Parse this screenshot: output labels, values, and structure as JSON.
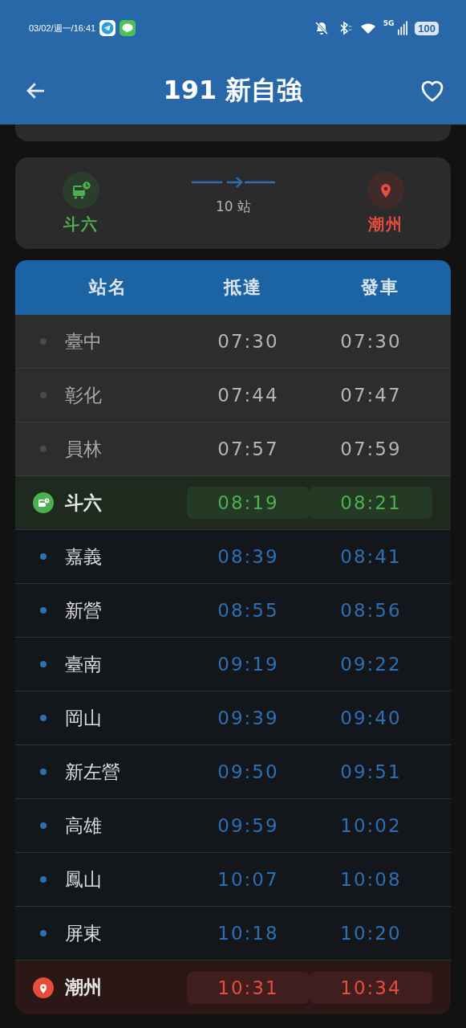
{
  "status_bar": {
    "datetime": "03/02/週一/16:41",
    "network": "5G",
    "battery": "100"
  },
  "app_bar": {
    "title": "191 新自強",
    "favorite": false
  },
  "route": {
    "origin": "斗六",
    "stops": "10 站",
    "destination": "潮州"
  },
  "table": {
    "columns": [
      "站名",
      "抵達",
      "發車"
    ],
    "rows": [
      {
        "kind": "passed",
        "station": "臺中",
        "arrive": "07:30",
        "depart": "07:30"
      },
      {
        "kind": "passed",
        "station": "彰化",
        "arrive": "07:44",
        "depart": "07:47"
      },
      {
        "kind": "passed",
        "station": "員林",
        "arrive": "07:57",
        "depart": "07:59"
      },
      {
        "kind": "boarding",
        "station": "斗六",
        "arrive": "08:19",
        "depart": "08:21"
      },
      {
        "kind": "upcoming",
        "station": "嘉義",
        "arrive": "08:39",
        "depart": "08:41"
      },
      {
        "kind": "upcoming",
        "station": "新營",
        "arrive": "08:55",
        "depart": "08:56"
      },
      {
        "kind": "upcoming",
        "station": "臺南",
        "arrive": "09:19",
        "depart": "09:22"
      },
      {
        "kind": "upcoming",
        "station": "岡山",
        "arrive": "09:39",
        "depart": "09:40"
      },
      {
        "kind": "upcoming",
        "station": "新左營",
        "arrive": "09:50",
        "depart": "09:51"
      },
      {
        "kind": "upcoming",
        "station": "高雄",
        "arrive": "09:59",
        "depart": "10:02"
      },
      {
        "kind": "upcoming",
        "station": "鳳山",
        "arrive": "10:07",
        "depart": "10:08"
      },
      {
        "kind": "upcoming",
        "station": "屏東",
        "arrive": "10:18",
        "depart": "10:20"
      },
      {
        "kind": "destination",
        "station": "潮州",
        "arrive": "10:31",
        "depart": "10:34"
      }
    ]
  }
}
